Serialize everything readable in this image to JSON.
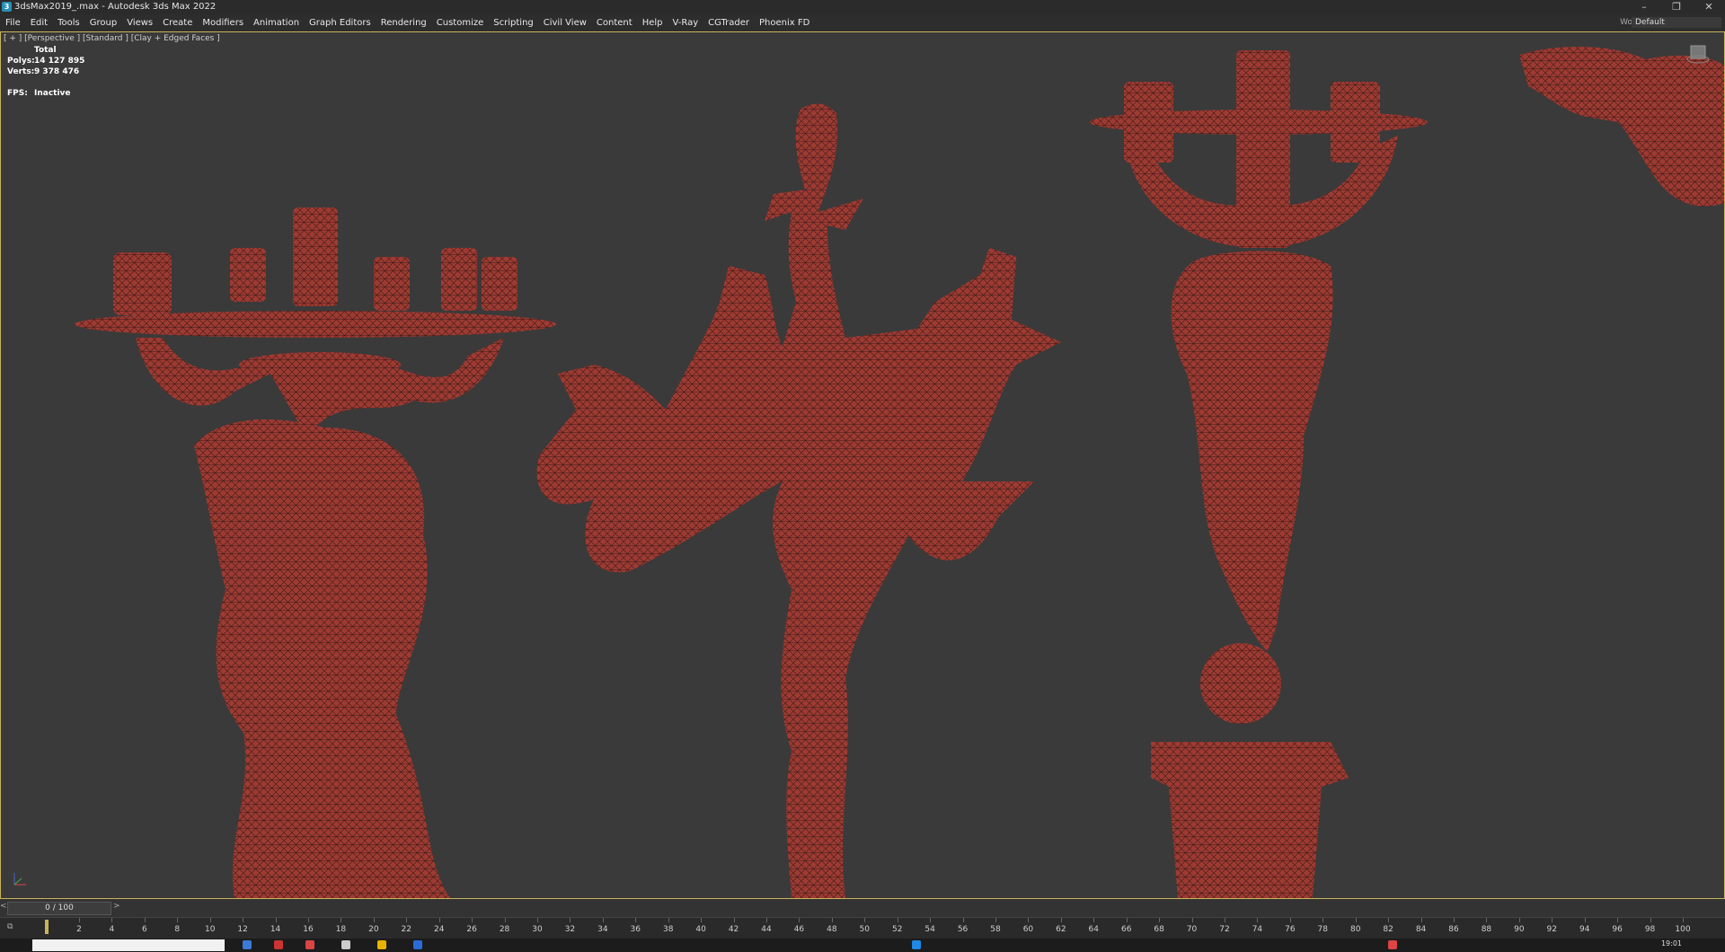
{
  "window": {
    "title": "3dsMax2019_.max - Autodesk 3ds Max 2022",
    "app_icon": "3"
  },
  "menu": [
    "File",
    "Edit",
    "Tools",
    "Group",
    "Views",
    "Create",
    "Modifiers",
    "Animation",
    "Graph Editors",
    "Rendering",
    "Customize",
    "Scripting",
    "Civil View",
    "Content",
    "Help",
    "V-Ray",
    "CGTrader",
    "Phoenix FD"
  ],
  "workspaces": {
    "label": "Workspaces:",
    "value": "Default"
  },
  "viewport": {
    "label": "[ + ] [Perspective ] [Standard ] [Clay + Edged Faces ]",
    "stats": {
      "header": "Total",
      "polys_label": "Polys:",
      "polys": "14 127 895",
      "verts_label": "Verts:",
      "verts": "9 378 476"
    },
    "fps_label": "FPS:",
    "fps_value": "Inactive"
  },
  "timeline": {
    "frame": "0 / 100",
    "prev": "<",
    "next": ">",
    "ticks": [
      "2",
      "4",
      "6",
      "8",
      "10",
      "12",
      "14",
      "16",
      "18",
      "20",
      "22",
      "24",
      "26",
      "28",
      "30",
      "32",
      "34",
      "36",
      "38",
      "40",
      "42",
      "44",
      "46",
      "48",
      "50",
      "52",
      "54",
      "56",
      "58",
      "60",
      "62",
      "64",
      "66",
      "68",
      "70",
      "72",
      "74",
      "76",
      "78",
      "80",
      "82",
      "84",
      "86",
      "88",
      "90",
      "92",
      "94",
      "96",
      "98",
      "100"
    ]
  },
  "taskbar": {
    "clock": "19:01"
  },
  "colors": {
    "model": "#9b3a33",
    "frame": "#c9b35a"
  }
}
